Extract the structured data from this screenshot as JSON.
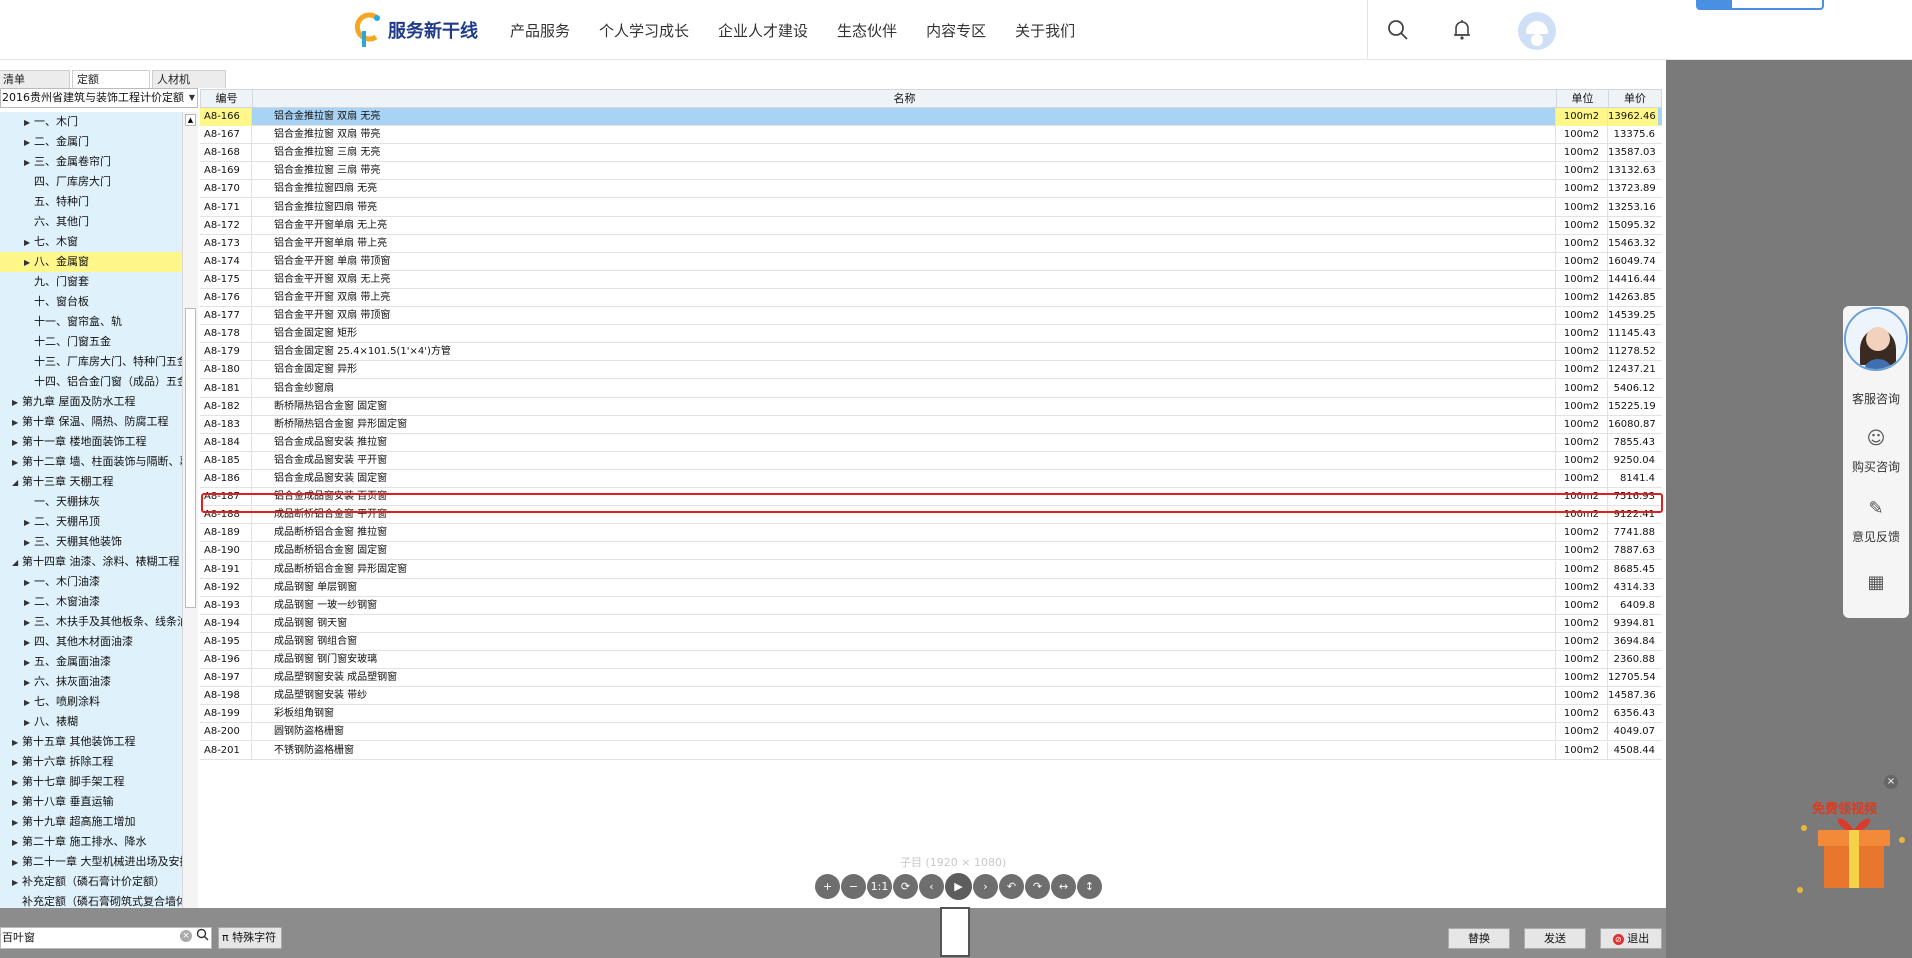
{
  "nav": {
    "logo": "服务新干线",
    "items": [
      "产品服务",
      "个人学习成长",
      "企业人才建设",
      "生态伙伴",
      "内容专区",
      "关于我们"
    ]
  },
  "left": {
    "tabs": [
      "清单",
      "定额",
      "人材机"
    ],
    "active_tab": "定额",
    "combo": "2016贵州省建筑与装饰工程计价定额",
    "tree": [
      {
        "label": "一、木门",
        "arrow": true,
        "indent": 2
      },
      {
        "label": "二、金属门",
        "arrow": true,
        "indent": 2
      },
      {
        "label": "三、金属卷帘门",
        "arrow": true,
        "indent": 2
      },
      {
        "label": "四、厂库房大门",
        "arrow": false,
        "indent": 2
      },
      {
        "label": "五、特种门",
        "arrow": false,
        "indent": 2
      },
      {
        "label": "六、其他门",
        "arrow": false,
        "indent": 2
      },
      {
        "label": "七、木窗",
        "arrow": true,
        "indent": 2
      },
      {
        "label": "八、金属窗",
        "arrow": true,
        "indent": 2,
        "selected": true
      },
      {
        "label": "九、门窗套",
        "arrow": false,
        "indent": 2
      },
      {
        "label": "十、窗台板",
        "arrow": false,
        "indent": 2
      },
      {
        "label": "十一、窗帘盒、轨",
        "arrow": false,
        "indent": 2
      },
      {
        "label": "十二、门窗五金",
        "arrow": false,
        "indent": 2
      },
      {
        "label": "十三、厂库房大门、特种门五金",
        "arrow": false,
        "indent": 2
      },
      {
        "label": "十四、铝合金门窗（成品）五金",
        "arrow": false,
        "indent": 2
      },
      {
        "label": "第九章 屋面及防水工程",
        "arrow": true,
        "indent": 1
      },
      {
        "label": "第十章 保温、隔热、防腐工程",
        "arrow": true,
        "indent": 1
      },
      {
        "label": "第十一章 楼地面装饰工程",
        "arrow": true,
        "indent": 1
      },
      {
        "label": "第十二章 墙、柱面装饰与隔断、幕",
        "arrow": true,
        "indent": 1
      },
      {
        "label": "第十三章 天棚工程",
        "arrow": true,
        "indent": 1,
        "open": true
      },
      {
        "label": "一、天棚抹灰",
        "arrow": false,
        "indent": 2
      },
      {
        "label": "二、天棚吊顶",
        "arrow": true,
        "indent": 2
      },
      {
        "label": "三、天棚其他装饰",
        "arrow": true,
        "indent": 2
      },
      {
        "label": "第十四章 油漆、涂料、裱糊工程",
        "arrow": true,
        "indent": 1,
        "open": true
      },
      {
        "label": "一、木门油漆",
        "arrow": true,
        "indent": 2
      },
      {
        "label": "二、木窗油漆",
        "arrow": true,
        "indent": 2
      },
      {
        "label": "三、木扶手及其他板条、线条油",
        "arrow": true,
        "indent": 2
      },
      {
        "label": "四、其他木材面油漆",
        "arrow": true,
        "indent": 2
      },
      {
        "label": "五、金属面油漆",
        "arrow": true,
        "indent": 2
      },
      {
        "label": "六、抹灰面油漆",
        "arrow": true,
        "indent": 2
      },
      {
        "label": "七、喷刷涂料",
        "arrow": true,
        "indent": 2
      },
      {
        "label": "八、裱糊",
        "arrow": true,
        "indent": 2
      },
      {
        "label": "第十五章 其他装饰工程",
        "arrow": true,
        "indent": 1
      },
      {
        "label": "第十六章 拆除工程",
        "arrow": true,
        "indent": 1
      },
      {
        "label": "第十七章 脚手架工程",
        "arrow": true,
        "indent": 1
      },
      {
        "label": "第十八章 垂直运输",
        "arrow": true,
        "indent": 1
      },
      {
        "label": "第十九章 超高施工增加",
        "arrow": true,
        "indent": 1
      },
      {
        "label": "第二十章 施工排水、降水",
        "arrow": true,
        "indent": 1
      },
      {
        "label": "第二十一章 大型机械进出场及安拆",
        "arrow": true,
        "indent": 1
      },
      {
        "label": "补充定额（磷石膏计价定额）",
        "arrow": true,
        "indent": 1
      },
      {
        "label": "补充定额（磷石膏砌筑式复合墙体",
        "arrow": false,
        "indent": 1
      }
    ]
  },
  "table": {
    "headers": [
      "编号",
      "名称",
      "单位",
      "单价"
    ],
    "rows": [
      [
        "A8-166",
        "铝合金推拉窗 双扇 无亮",
        "100m2",
        "13962.46"
      ],
      [
        "A8-167",
        "铝合金推拉窗 双扇 带亮",
        "100m2",
        "13375.6"
      ],
      [
        "A8-168",
        "铝合金推拉窗 三扇 无亮",
        "100m2",
        "13587.03"
      ],
      [
        "A8-169",
        "铝合金推拉窗 三扇 带亮",
        "100m2",
        "13132.63"
      ],
      [
        "A8-170",
        "铝合金推拉窗四扇 无亮",
        "100m2",
        "13723.89"
      ],
      [
        "A8-171",
        "铝合金推拉窗四扇 带亮",
        "100m2",
        "13253.16"
      ],
      [
        "A8-172",
        "铝合金平开窗单扇 无上亮",
        "100m2",
        "15095.32"
      ],
      [
        "A8-173",
        "铝合金平开窗单扇 带上亮",
        "100m2",
        "15463.32"
      ],
      [
        "A8-174",
        "铝合金平开窗 单扇 带顶窗",
        "100m2",
        "16049.74"
      ],
      [
        "A8-175",
        "铝合金平开窗 双扇 无上亮",
        "100m2",
        "14416.44"
      ],
      [
        "A8-176",
        "铝合金平开窗 双扇 带上亮",
        "100m2",
        "14263.85"
      ],
      [
        "A8-177",
        "铝合金平开窗 双扇 带顶窗",
        "100m2",
        "14539.25"
      ],
      [
        "A8-178",
        "铝合金固定窗 矩形",
        "100m2",
        "11145.43"
      ],
      [
        "A8-179",
        "铝合金固定窗 25.4×101.5(1'×4')方管",
        "100m2",
        "11278.52"
      ],
      [
        "A8-180",
        "铝合金固定窗 异形",
        "100m2",
        "12437.21"
      ],
      [
        "A8-181",
        "铝合金纱窗扇",
        "100m2",
        "5406.12"
      ],
      [
        "A8-182",
        "断桥隔热铝合金窗 固定窗",
        "100m2",
        "15225.19"
      ],
      [
        "A8-183",
        "断桥隔热铝合金窗 异形固定窗",
        "100m2",
        "16080.87"
      ],
      [
        "A8-184",
        "铝合金成品窗安装 推拉窗",
        "100m2",
        "7855.43"
      ],
      [
        "A8-185",
        "铝合金成品窗安装 平开窗",
        "100m2",
        "9250.04"
      ],
      [
        "A8-186",
        "铝合金成品窗安装 固定窗",
        "100m2",
        "8141.4"
      ],
      [
        "A8-187",
        "铝合金成品窗安装 百页窗",
        "100m2",
        "7516.93"
      ],
      [
        "A8-188",
        "成品断桥铝合金窗 平开窗",
        "100m2",
        "9122.41"
      ],
      [
        "A8-189",
        "成品断桥铝合金窗 推拉窗",
        "100m2",
        "7741.88"
      ],
      [
        "A8-190",
        "成品断桥铝合金窗 固定窗",
        "100m2",
        "7887.63"
      ],
      [
        "A8-191",
        "成品断桥铝合金窗 异形固定窗",
        "100m2",
        "8685.45"
      ],
      [
        "A8-192",
        "成品钢窗 单层钢窗",
        "100m2",
        "4314.33"
      ],
      [
        "A8-193",
        "成品钢窗 一玻一纱钢窗",
        "100m2",
        "6409.8"
      ],
      [
        "A8-194",
        "成品钢窗 钢天窗",
        "100m2",
        "9394.81"
      ],
      [
        "A8-195",
        "成品钢窗 钢组合窗",
        "100m2",
        "3694.84"
      ],
      [
        "A8-196",
        "成品钢窗 钢门窗安玻璃",
        "100m2",
        "2360.88"
      ],
      [
        "A8-197",
        "成品塑钢窗安装 成品塑钢窗",
        "100m2",
        "12705.54"
      ],
      [
        "A8-198",
        "成品塑钢窗安装 带纱",
        "100m2",
        "14587.36"
      ],
      [
        "A8-199",
        "彩板组角钢窗",
        "100m2",
        "6356.43"
      ],
      [
        "A8-200",
        "圆钢防盗格栅窗",
        "100m2",
        "4049.07"
      ],
      [
        "A8-201",
        "不锈钢防盗格栅窗",
        "100m2",
        "4508.44"
      ]
    ],
    "selected_row": 0,
    "boxed_row": 21
  },
  "viewer": {
    "title": "子目 (1920 × 1080)",
    "buttons": [
      "+",
      "−",
      "1:1",
      "⟳",
      "‹",
      "▶",
      "›",
      "↶",
      "↷",
      "↔",
      "↕"
    ]
  },
  "bottom": {
    "search_value": "百叶窗",
    "special": "π 特殊字符",
    "replace": "替换",
    "send": "发送",
    "exit": "退出"
  },
  "side": {
    "service": "客服咨询",
    "buy": "购买咨询",
    "feedback": "意见反馈",
    "promo": "免费领视频"
  },
  "colors": {
    "selected_row": "#a9d3f5",
    "highlight": "#fff78a",
    "box": "#e02020",
    "tree_bg": "#dff1fb"
  }
}
